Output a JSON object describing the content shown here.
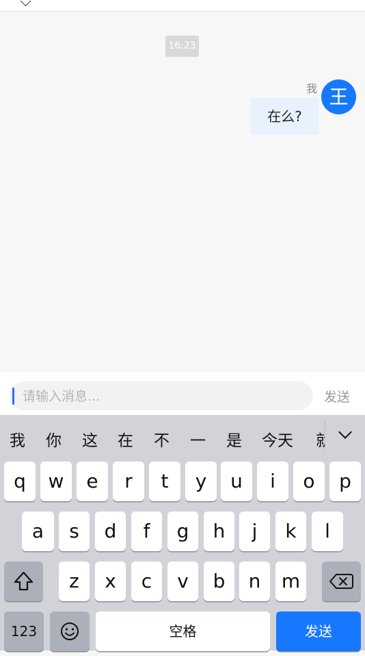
{
  "chat": {
    "time": "16:23",
    "message": {
      "sender": "我",
      "avatar_text": "王",
      "text": "在么?"
    }
  },
  "input": {
    "placeholder": "请输入消息...",
    "send_label": "发送"
  },
  "keyboard": {
    "candidates": [
      "我",
      "你",
      "这",
      "在",
      "不",
      "一",
      "是",
      "今天"
    ],
    "candidate_partial": "就",
    "row1": [
      "q",
      "w",
      "e",
      "r",
      "t",
      "y",
      "u",
      "i",
      "o",
      "p"
    ],
    "row2": [
      "a",
      "s",
      "d",
      "f",
      "g",
      "h",
      "j",
      "k",
      "l"
    ],
    "row3": [
      "z",
      "x",
      "c",
      "v",
      "b",
      "n",
      "m"
    ],
    "numbers_label": "123",
    "space_label": "空格",
    "send_label": "发送",
    "colors": {
      "send": "#1677ff",
      "avatar": "#1677ff",
      "bubble": "#e8f2fd"
    }
  }
}
